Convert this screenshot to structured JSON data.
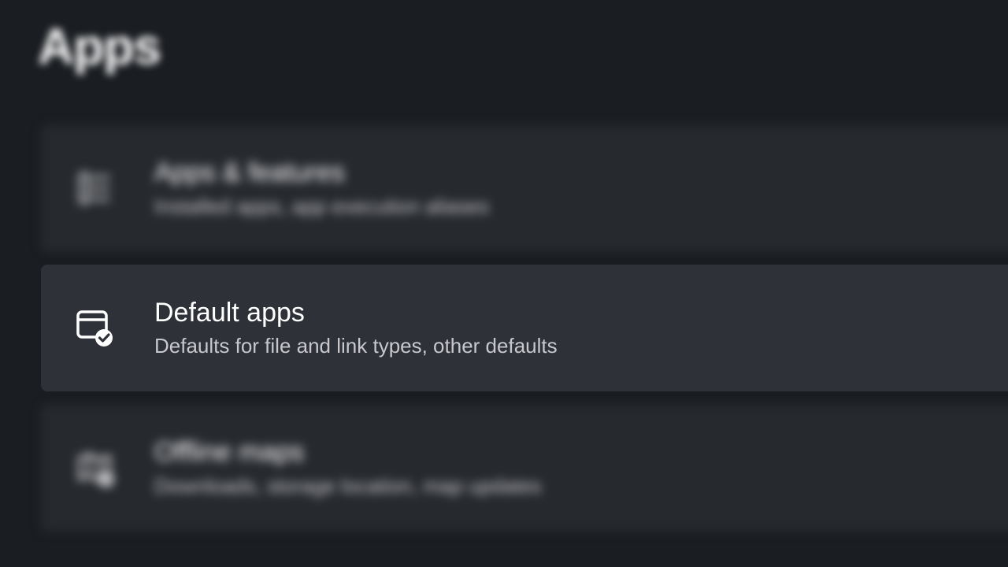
{
  "header": {
    "title": "Apps"
  },
  "items": [
    {
      "title": "Apps & features",
      "description": "Installed apps, app execution aliases"
    },
    {
      "title": "Default apps",
      "description": "Defaults for file and link types, other defaults"
    },
    {
      "title": "Offline maps",
      "description": "Downloads, storage location, map updates"
    }
  ]
}
